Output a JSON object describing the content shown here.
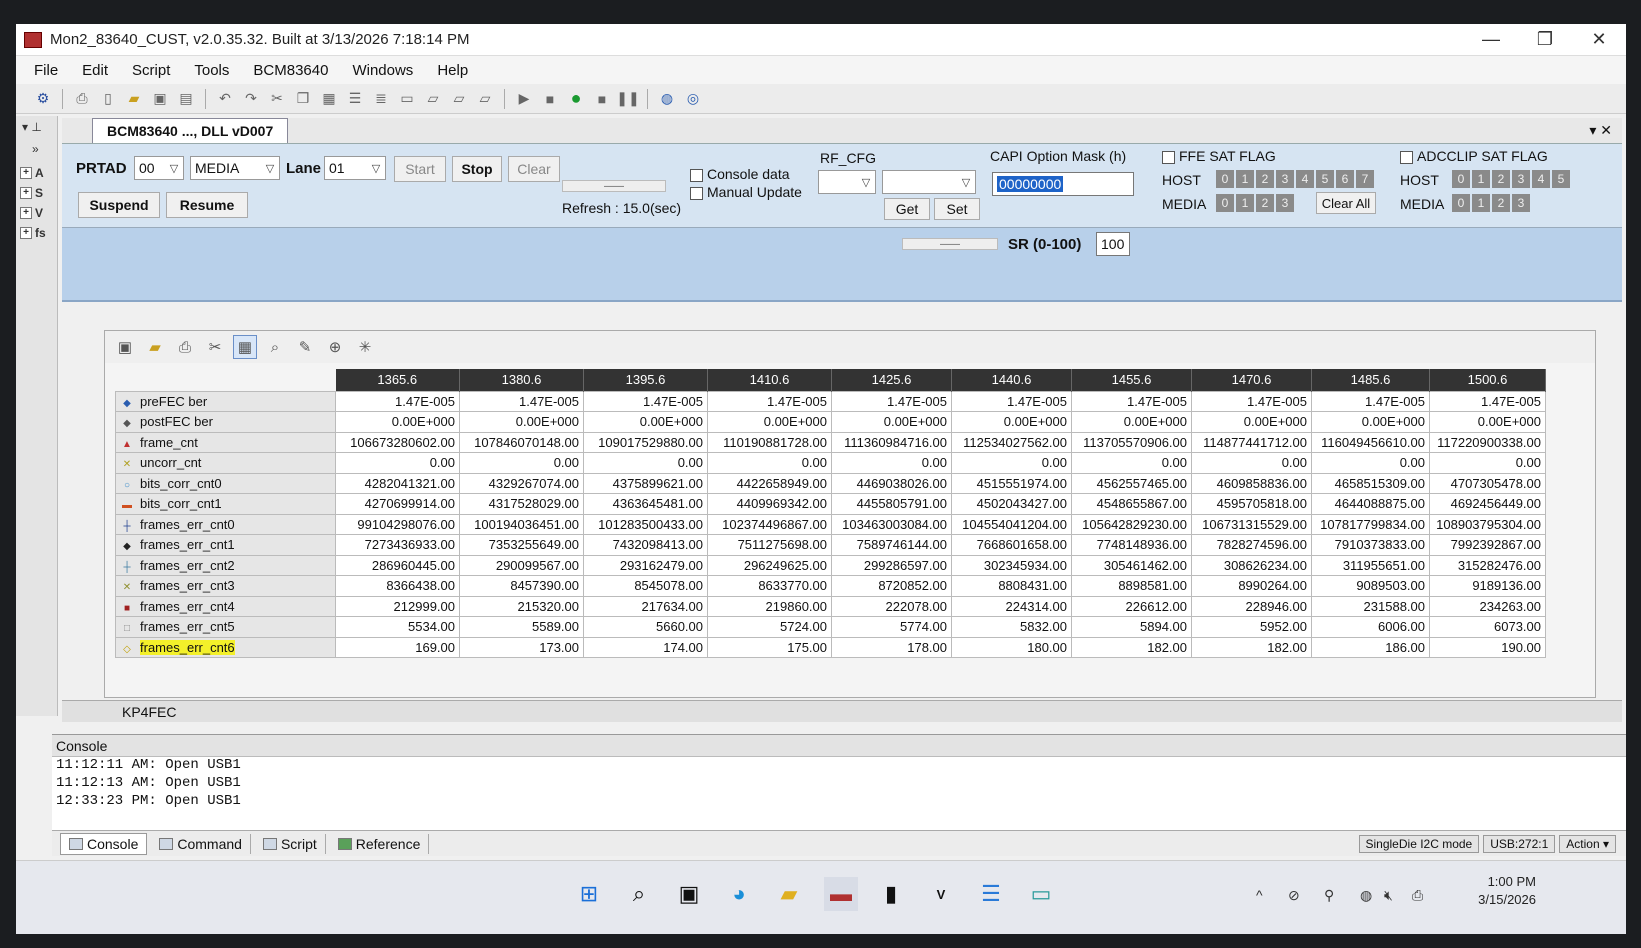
{
  "window": {
    "title": "Mon2_83640_CUST, v2.0.35.32.  Built at 3/13/2026 7:18:14 PM",
    "minimize": "—",
    "restore": "❐",
    "close": "✕"
  },
  "menu": [
    "File",
    "Edit",
    "Script",
    "Tools",
    "BCM83640",
    "Windows",
    "Help"
  ],
  "dock": {
    "pin": "▾ ⊥",
    "expand": "»",
    "nodes": [
      "A",
      "S",
      "V",
      "fs"
    ],
    "node_toggle": "+"
  },
  "doc_tab": {
    "label": "BCM83640 ..., DLL vD007",
    "close": "▾ ✕"
  },
  "controls": {
    "prtad_label": "PRTAD",
    "prtad_value": "00",
    "media_value": "MEDIA",
    "lane_label": "Lane",
    "lane_value": "01",
    "start_label": "Start",
    "stop_label": "Stop",
    "clear_label": "Clear",
    "suspend_label": "Suspend",
    "resume_label": "Resume",
    "refresh_text": "Refresh : 15.0(sec)",
    "console_data_label": "Console data",
    "manual_update_label": "Manual Update",
    "rf_cfg_label": "RF_CFG",
    "get_label": "Get",
    "set_label": "Set",
    "capi_label": "CAPI Option Mask (h)",
    "capi_value": "00000000",
    "ffe_sat_flag_label": "FFE SAT FLAG",
    "adcclip_sat_flag_label": "ADCCLIP SAT FLAG",
    "host_label": "HOST",
    "media_label": "MEDIA",
    "host_bits": [
      "0",
      "1",
      "2",
      "3",
      "4",
      "5",
      "6",
      "7"
    ],
    "media_bits": [
      "0",
      "1",
      "2",
      "3"
    ],
    "adc_host_bits": [
      "0",
      "1",
      "2",
      "3",
      "4",
      "5"
    ],
    "adc_media_bits": [
      "0",
      "1",
      "2",
      "3"
    ],
    "clear_all_label": "Clear All",
    "sr_label": "SR (0-100)",
    "sr_value": "100",
    "slider_mark": "——"
  },
  "grid": {
    "columns": [
      "1365.6",
      "1380.6",
      "1395.6",
      "1410.6",
      "1425.6",
      "1440.6",
      "1455.6",
      "1470.6",
      "1485.6",
      "1500.6"
    ],
    "rows": [
      {
        "name": "preFEC ber",
        "marker": "◆",
        "color": "#2a5db0",
        "values": [
          "1.47E-005",
          "1.47E-005",
          "1.47E-005",
          "1.47E-005",
          "1.47E-005",
          "1.47E-005",
          "1.47E-005",
          "1.47E-005",
          "1.47E-005",
          "1.47E-005"
        ]
      },
      {
        "name": "postFEC ber",
        "marker": "◆",
        "color": "#555555",
        "values": [
          "0.00E+000",
          "0.00E+000",
          "0.00E+000",
          "0.00E+000",
          "0.00E+000",
          "0.00E+000",
          "0.00E+000",
          "0.00E+000",
          "0.00E+000",
          "0.00E+000"
        ]
      },
      {
        "name": "frame_cnt",
        "marker": "▲",
        "color": "#c03030",
        "values": [
          "106673280602.00",
          "107846070148.00",
          "109017529880.00",
          "110190881728.00",
          "111360984716.00",
          "112534027562.00",
          "113705570906.00",
          "114877441712.00",
          "116049456610.00",
          "117220900338.00"
        ]
      },
      {
        "name": "uncorr_cnt",
        "marker": "✕",
        "color": "#b0a020",
        "values": [
          "0.00",
          "0.00",
          "0.00",
          "0.00",
          "0.00",
          "0.00",
          "0.00",
          "0.00",
          "0.00",
          "0.00"
        ]
      },
      {
        "name": "bits_corr_cnt0",
        "marker": "○",
        "color": "#3a8ac8",
        "values": [
          "4282041321.00",
          "4329267074.00",
          "4375899621.00",
          "4422658949.00",
          "4469038026.00",
          "4515551974.00",
          "4562557465.00",
          "4609858836.00",
          "4658515309.00",
          "4707305478.00"
        ]
      },
      {
        "name": "bits_corr_cnt1",
        "marker": "▬",
        "color": "#d05020",
        "values": [
          "4270699914.00",
          "4317528029.00",
          "4363645481.00",
          "4409969342.00",
          "4455805791.00",
          "4502043427.00",
          "4548655867.00",
          "4595705818.00",
          "4644088875.00",
          "4692456449.00"
        ]
      },
      {
        "name": "frames_err_cnt0",
        "marker": "┼",
        "color": "#204090",
        "values": [
          "99104298076.00",
          "100194036451.00",
          "101283500433.00",
          "102374496867.00",
          "103463003084.00",
          "104554041204.00",
          "105642829230.00",
          "106731315529.00",
          "107817799834.00",
          "108903795304.00"
        ]
      },
      {
        "name": "frames_err_cnt1",
        "marker": "◆",
        "color": "#222222",
        "values": [
          "7273436933.00",
          "7353255649.00",
          "7432098413.00",
          "7511275698.00",
          "7589746144.00",
          "7668601658.00",
          "7748148936.00",
          "7828274596.00",
          "7910373833.00",
          "7992392867.00"
        ]
      },
      {
        "name": "frames_err_cnt2",
        "marker": "┼",
        "color": "#3a7aa0",
        "values": [
          "286960445.00",
          "290099567.00",
          "293162479.00",
          "296249625.00",
          "299286597.00",
          "302345934.00",
          "305461462.00",
          "308626234.00",
          "311955651.00",
          "315282476.00"
        ]
      },
      {
        "name": "frames_err_cnt3",
        "marker": "✕",
        "color": "#909030",
        "values": [
          "8366438.00",
          "8457390.00",
          "8545078.00",
          "8633770.00",
          "8720852.00",
          "8808431.00",
          "8898581.00",
          "8990264.00",
          "9089503.00",
          "9189136.00"
        ]
      },
      {
        "name": "frames_err_cnt4",
        "marker": "■",
        "color": "#a02020",
        "values": [
          "212999.00",
          "215320.00",
          "217634.00",
          "219860.00",
          "222078.00",
          "224314.00",
          "226612.00",
          "228946.00",
          "231588.00",
          "234263.00"
        ]
      },
      {
        "name": "frames_err_cnt5",
        "marker": "□",
        "color": "#888888",
        "values": [
          "5534.00",
          "5589.00",
          "5660.00",
          "5724.00",
          "5774.00",
          "5832.00",
          "5894.00",
          "5952.00",
          "6006.00",
          "6073.00"
        ]
      },
      {
        "name": "frames_err_cnt6",
        "marker": "◇",
        "color": "#c0a000",
        "values": [
          "169.00",
          "173.00",
          "174.00",
          "175.00",
          "178.00",
          "180.00",
          "182.00",
          "182.00",
          "186.00",
          "190.00"
        ]
      }
    ]
  },
  "kp4_label": "KP4FEC",
  "console": {
    "title": "Console",
    "lines": [
      "11:12:11 AM: Open USB1",
      "11:12:13 AM: Open USB1",
      "12:33:23 PM: Open USB1"
    ]
  },
  "bottom_tabs": [
    "Console",
    "Command",
    "Script",
    "Reference"
  ],
  "status": [
    "SingleDie I2C mode",
    "USB:272:1",
    "Action ▾"
  ],
  "taskbar": {
    "time": "1:00 PM",
    "date": "3/15/2026",
    "tray_up": "^"
  }
}
